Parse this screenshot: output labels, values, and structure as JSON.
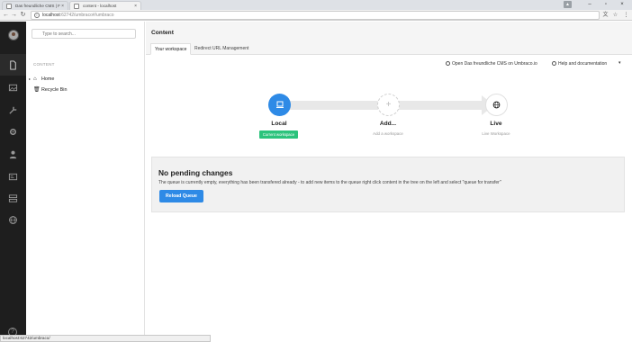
{
  "browser": {
    "tabs": [
      {
        "title": "Das freundliche CMS | F"
      },
      {
        "title": "content - localhost"
      }
    ],
    "url_host": "localhost",
    "url_path": ":62742/umbraco#/umbraco"
  },
  "search": {
    "placeholder": "Type to search..."
  },
  "tree": {
    "heading": "CONTENT",
    "items": [
      {
        "label": "Home",
        "icon": "home-icon"
      },
      {
        "label": "Recycle Bin",
        "icon": "trash-icon"
      }
    ]
  },
  "main": {
    "title": "Content",
    "tabs": [
      {
        "label": "Your workspace",
        "active": true
      },
      {
        "label": "Redirect URL Management",
        "active": false
      }
    ],
    "links": {
      "open_cloud": "Open Das freundliche CMS on Umbraco.io",
      "help": "Help and documentation"
    }
  },
  "workflow": {
    "steps": [
      {
        "label": "Local",
        "sub": "",
        "badge": "Current workspace",
        "icon": "laptop-icon"
      },
      {
        "label": "Add...",
        "sub": "Add a workspace",
        "icon": "plus-icon"
      },
      {
        "label": "Live",
        "sub": "Live Workspace",
        "icon": "globe-icon"
      }
    ]
  },
  "panel": {
    "title": "No pending changes",
    "description": "The queue is currently empty, everything has been transfered already - to add new items to the queue right click content in the tree on the left and select \"queue for transfer\"",
    "button": "Reload Queue"
  },
  "status_bar": "localhost:62742/umbraco/",
  "colors": {
    "accent": "#2e8ae6",
    "badge": "#2bc37c",
    "sidebar": "#1e1e1e"
  }
}
